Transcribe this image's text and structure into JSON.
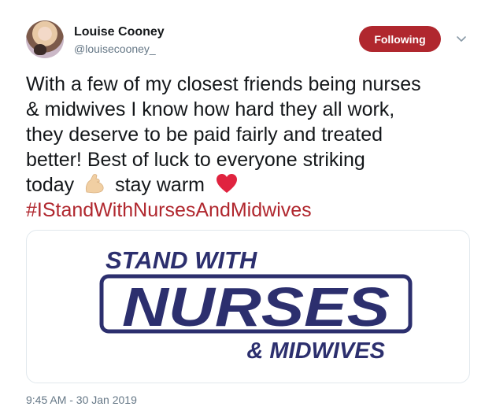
{
  "author": {
    "name": "Louise Cooney",
    "handle": "@louisecooney_"
  },
  "follow_button": {
    "label": "Following",
    "color": "#b0272e"
  },
  "icons": {
    "menu": "chevron-down-icon",
    "emoji_1": "flexed-biceps-icon",
    "emoji_2": "red-heart-icon"
  },
  "tweet": {
    "lines": [
      "With a few of my closest friends being nurses",
      "& midwives I know how hard they all work,",
      "they deserve to be paid fairly and treated",
      "better! Best of luck to everyone striking"
    ],
    "last_line_before_emoji": "today",
    "last_line_after_emoji": "stay warm",
    "hashtag": "#IStandWithNursesAndMidwives"
  },
  "media": {
    "line_1": "STAND WITH",
    "line_2": "NURSES",
    "line_3": "& MIDWIVES",
    "text_color": "#2c2f6e"
  },
  "timestamp": "9:45 AM - 30 Jan 2019"
}
